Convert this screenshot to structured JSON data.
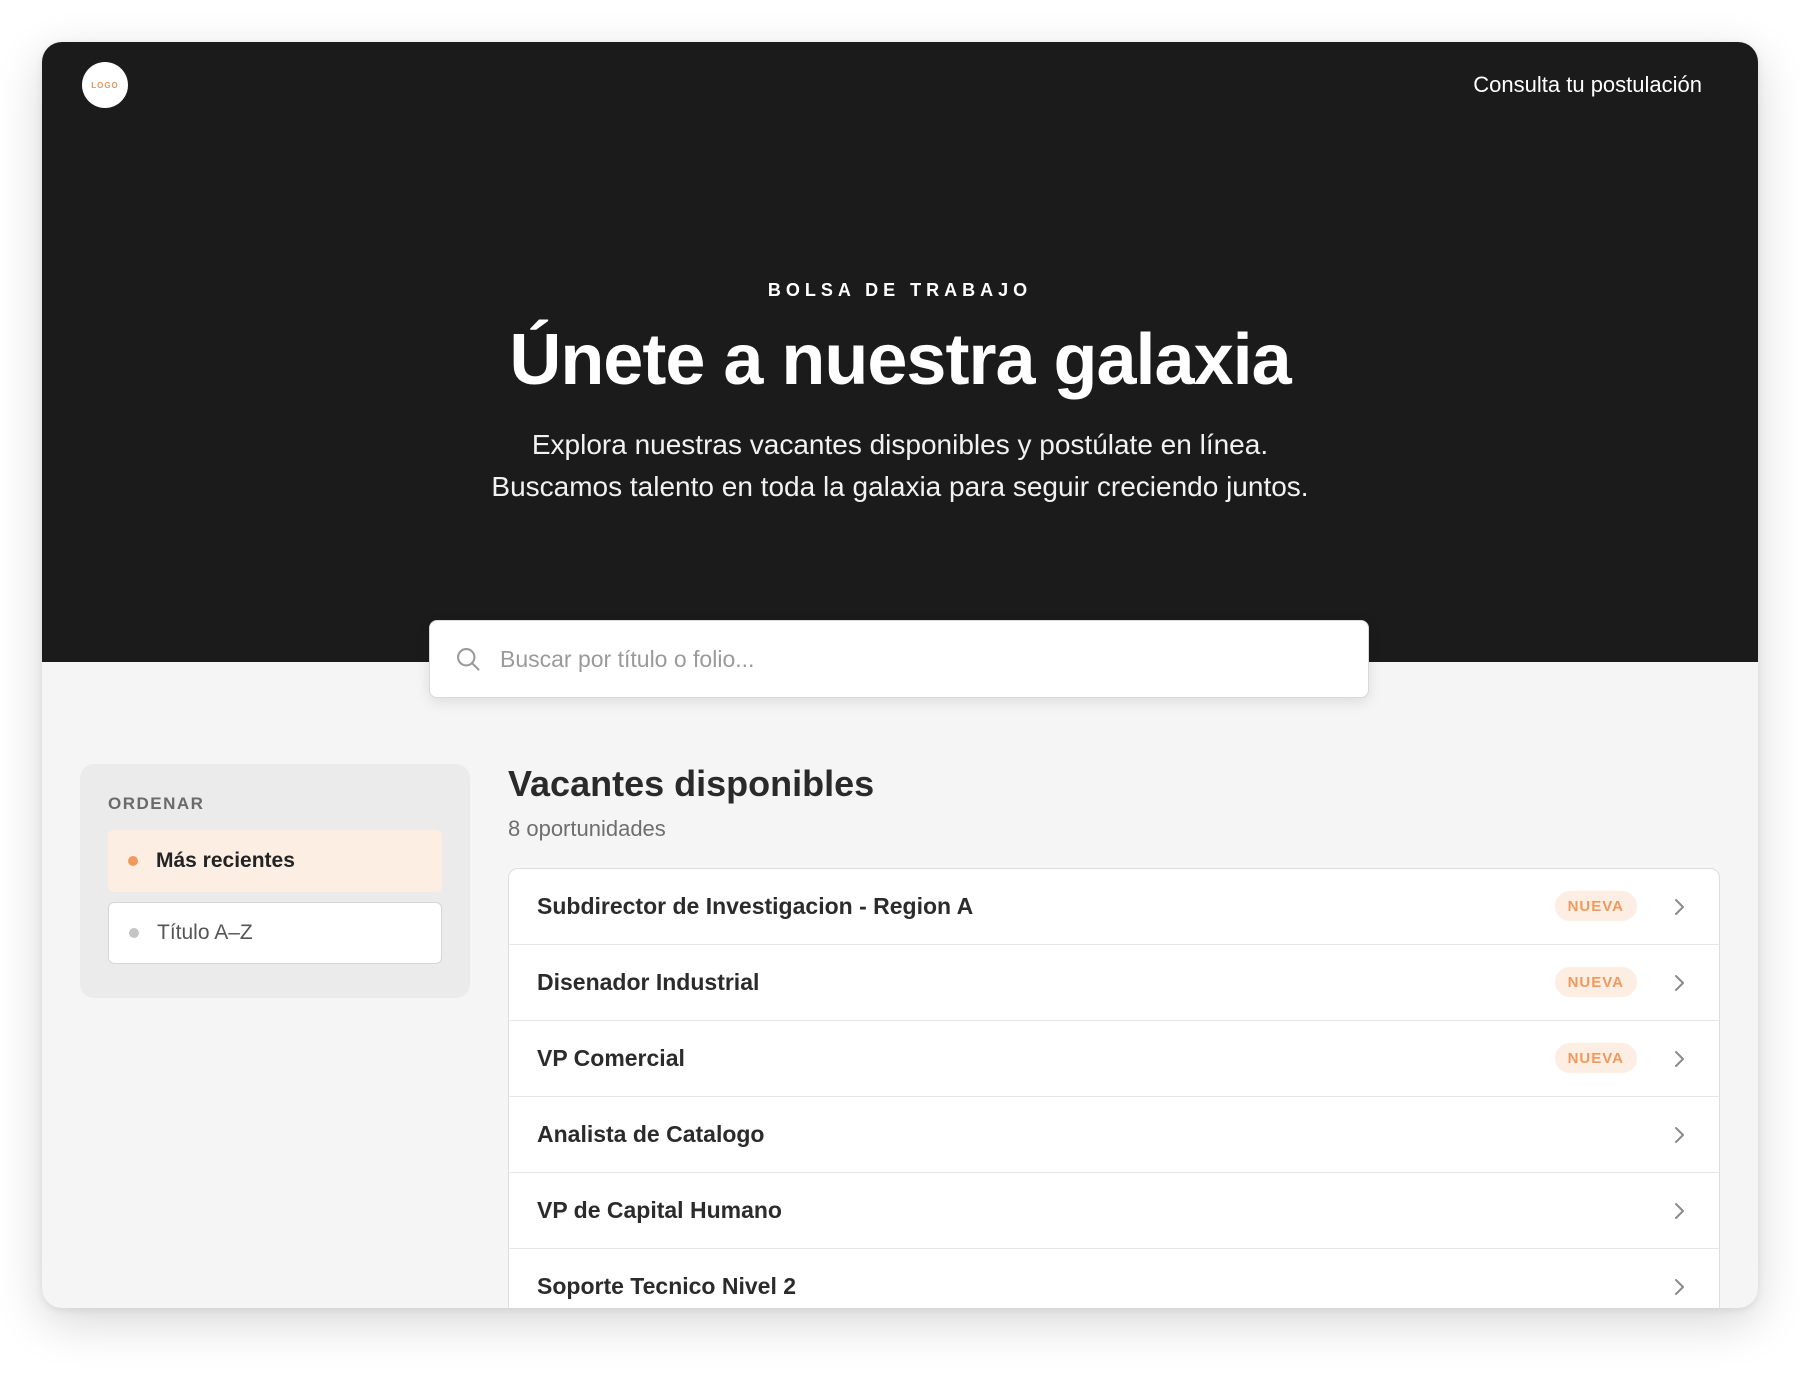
{
  "header": {
    "logo_text": "LOGO",
    "link_label": "Consulta tu postulación"
  },
  "hero": {
    "eyebrow": "BOLSA DE TRABAJO",
    "title": "Únete a nuestra galaxia",
    "subtitle_line1": "Explora nuestras vacantes disponibles y postúlate en línea.",
    "subtitle_line2": "Buscamos talento en toda la galaxia para seguir creciendo juntos."
  },
  "search": {
    "placeholder": "Buscar por título o folio...",
    "value": "",
    "icon": "search-icon"
  },
  "sort": {
    "heading": "ORDENAR",
    "options": [
      {
        "label": "Más recientes",
        "selected": true
      },
      {
        "label": "Título A–Z",
        "selected": false
      }
    ]
  },
  "listing": {
    "title": "Vacantes disponibles",
    "count_label": "8 oportunidades",
    "badge_label": "NUEVA",
    "jobs": [
      {
        "title": "Subdirector de Investigacion - Region A",
        "badge": "NUEVA"
      },
      {
        "title": "Disenador Industrial",
        "badge": "NUEVA"
      },
      {
        "title": "VP Comercial",
        "badge": "NUEVA"
      },
      {
        "title": "Analista de Catalogo",
        "badge": ""
      },
      {
        "title": "VP de Capital Humano",
        "badge": ""
      },
      {
        "title": "Soporte Tecnico Nivel 2",
        "badge": ""
      }
    ]
  },
  "colors": {
    "hero_bg": "#1b1b1b",
    "accent": "#ef9a5c",
    "accent_soft": "#fdeee3",
    "page_bg": "#f5f5f5"
  }
}
